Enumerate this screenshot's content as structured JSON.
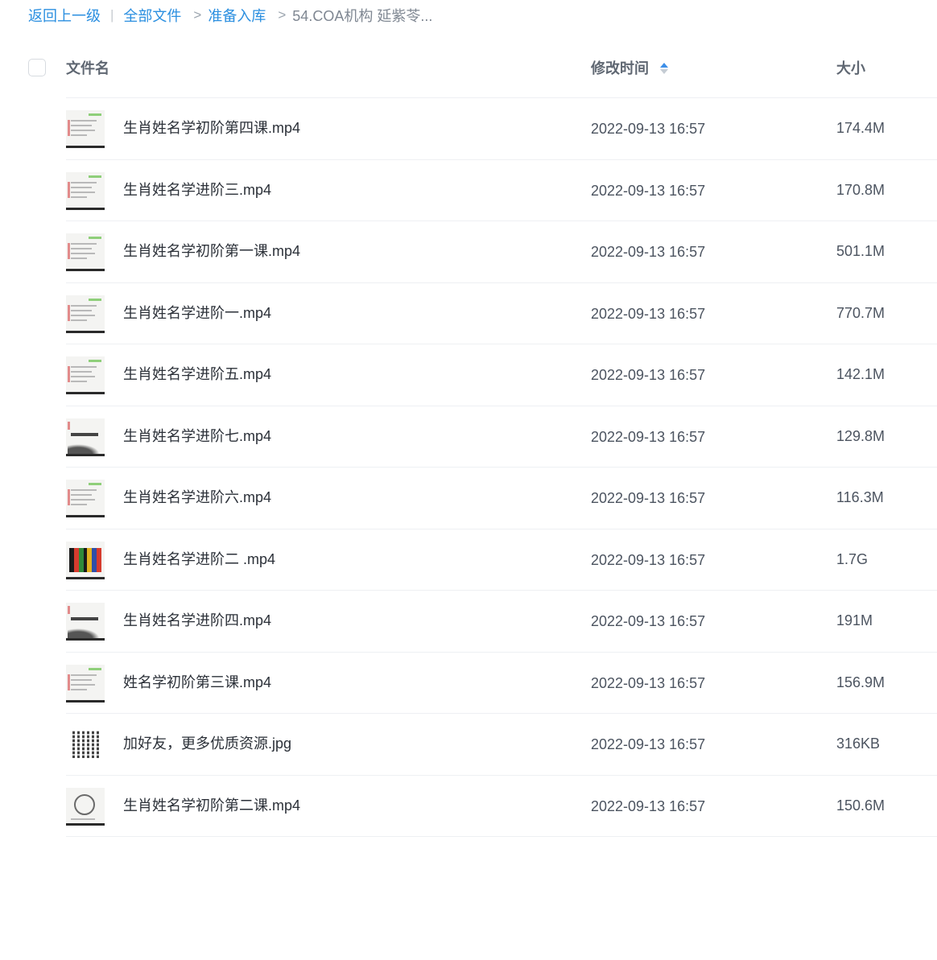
{
  "breadcrumb": {
    "back": "返回上一级",
    "items": [
      "全部文件",
      "准备入库"
    ],
    "current": "54.COA机构 延紫苓..."
  },
  "table": {
    "columns": {
      "name": "文件名",
      "time": "修改时间",
      "size": "大小"
    },
    "sort": {
      "column": "time",
      "direction": "ascending"
    },
    "accent_color": "#2b8fe0",
    "rows": [
      {
        "name": "生肖姓名学初阶第四课.mp4",
        "time": "2022-09-13 16:57",
        "size": "174.4M",
        "thumb": "video-slide-icon"
      },
      {
        "name": "生肖姓名学进阶三.mp4",
        "time": "2022-09-13 16:57",
        "size": "170.8M",
        "thumb": "video-slide-icon"
      },
      {
        "name": "生肖姓名学初阶第一课.mp4",
        "time": "2022-09-13 16:57",
        "size": "501.1M",
        "thumb": "video-slide-icon"
      },
      {
        "name": "生肖姓名学进阶一.mp4",
        "time": "2022-09-13 16:57",
        "size": "770.7M",
        "thumb": "video-slide-icon"
      },
      {
        "name": "生肖姓名学进阶五.mp4",
        "time": "2022-09-13 16:57",
        "size": "142.1M",
        "thumb": "video-slide-icon"
      },
      {
        "name": "生肖姓名学进阶七.mp4",
        "time": "2022-09-13 16:57",
        "size": "129.8M",
        "thumb": "video-ink-icon"
      },
      {
        "name": "生肖姓名学进阶六.mp4",
        "time": "2022-09-13 16:57",
        "size": "116.3M",
        "thumb": "video-slide-icon"
      },
      {
        "name": "生肖姓名学进阶二 .mp4",
        "time": "2022-09-13 16:57",
        "size": "1.7G",
        "thumb": "video-stripes-icon"
      },
      {
        "name": "生肖姓名学进阶四.mp4",
        "time": "2022-09-13 16:57",
        "size": "191M",
        "thumb": "video-ink-icon"
      },
      {
        "name": "姓名学初阶第三课.mp4",
        "time": "2022-09-13 16:57",
        "size": "156.9M",
        "thumb": "video-slide-icon"
      },
      {
        "name": "加好友，更多优质资源.jpg",
        "time": "2022-09-13 16:57",
        "size": "316KB",
        "thumb": "qr-code-icon"
      },
      {
        "name": "生肖姓名学初阶第二课.mp4",
        "time": "2022-09-13 16:57",
        "size": "150.6M",
        "thumb": "video-star-icon"
      }
    ]
  }
}
